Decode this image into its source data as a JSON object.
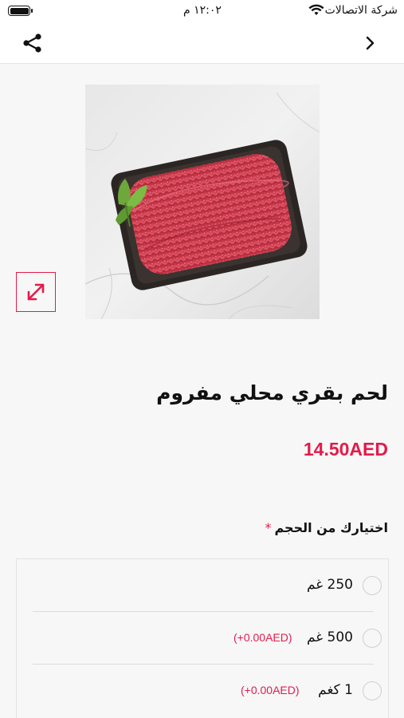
{
  "status_bar": {
    "carrier": "شركة الاتصالات",
    "time": "١٢:٠٢ م"
  },
  "product": {
    "title": "لحم بقري محلي مفروم",
    "price": "14.50AED",
    "image_alt": "minced beef tray"
  },
  "size_section": {
    "label": "اختيارك من الحجم",
    "required_mark": "*",
    "options": [
      {
        "label": "250 غم",
        "extra": ""
      },
      {
        "label": "500 غم",
        "extra": "(+0.00AED)"
      },
      {
        "label": "1 كغم",
        "extra": "(+0.00AED)"
      }
    ]
  },
  "colors": {
    "accent": "#e31b4a"
  }
}
